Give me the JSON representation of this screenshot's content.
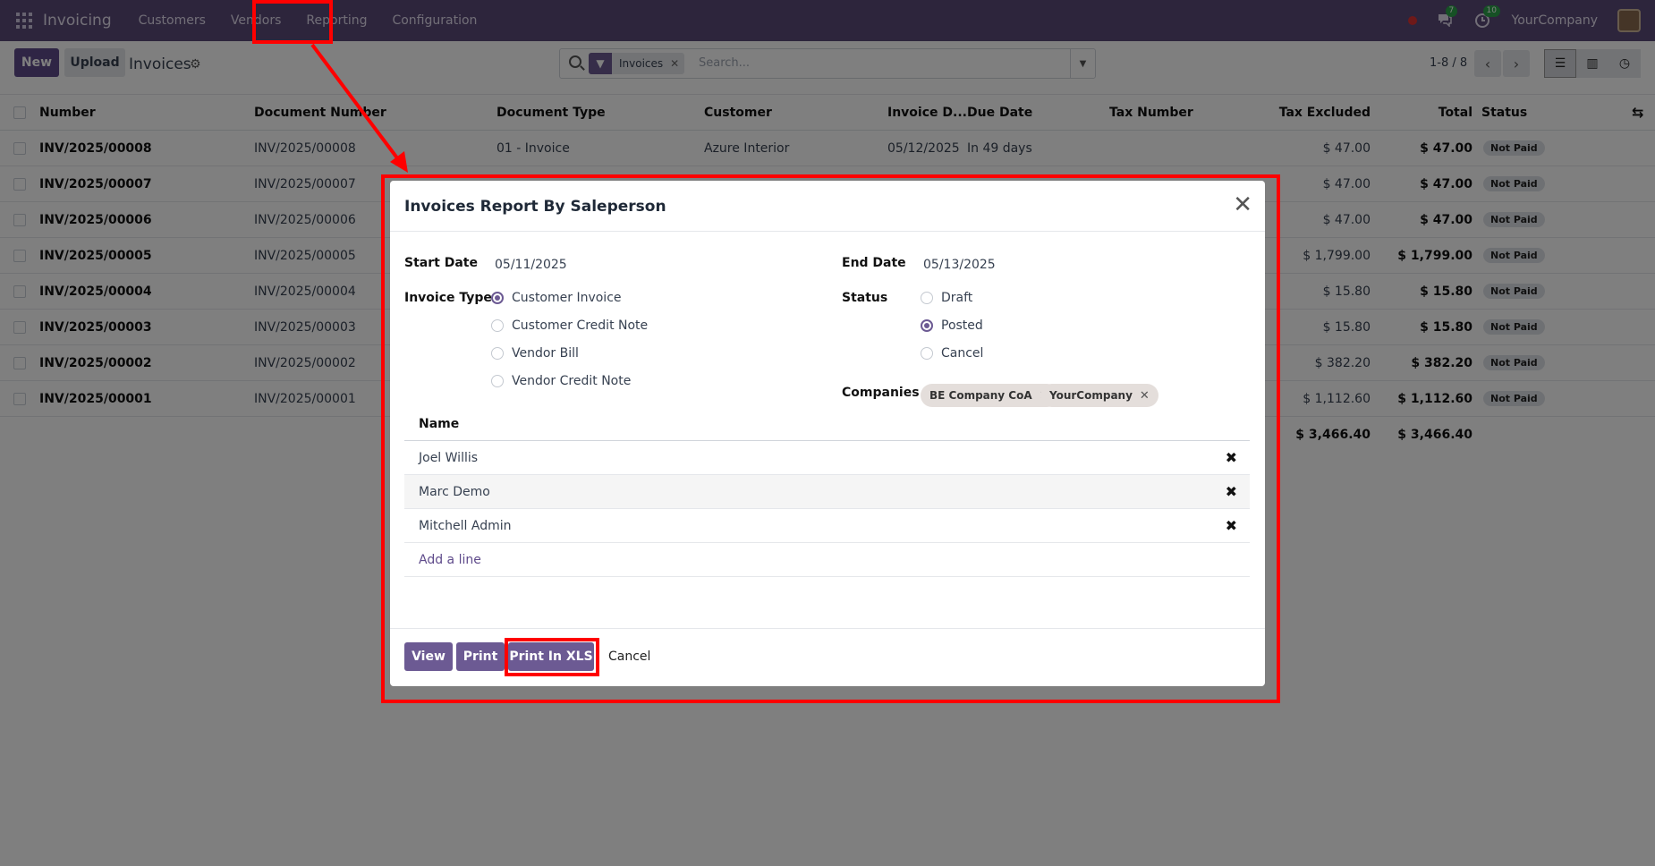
{
  "navbar": {
    "app_name": "Invoicing",
    "menu": [
      "Customers",
      "Vendors",
      "Reporting",
      "Configuration"
    ],
    "messages_count": "7",
    "activities_count": "10",
    "company": "YourCompany"
  },
  "control": {
    "new_label": "New",
    "upload_label": "Upload",
    "breadcrumb": "Invoices",
    "facet": "Invoices",
    "search_placeholder": "Search...",
    "pager": "1-8 / 8"
  },
  "table": {
    "headers": [
      "Number",
      "Document Number",
      "Document Type",
      "Customer",
      "Invoice D...",
      "Due Date",
      "Tax Number",
      "Tax Excluded",
      "Total",
      "Status"
    ],
    "rows": [
      {
        "number": "INV/2025/00008",
        "doc": "INV/2025/00008",
        "type": "01 - Invoice",
        "customer": "Azure Interior",
        "date": "05/12/2025",
        "due": "In 49 days",
        "excl": "$ 47.00",
        "total": "$ 47.00",
        "status": "Not Paid"
      },
      {
        "number": "INV/2025/00007",
        "doc": "INV/2025/00007",
        "excl": "$ 47.00",
        "total": "$ 47.00",
        "status": "Not Paid"
      },
      {
        "number": "INV/2025/00006",
        "doc": "INV/2025/00006",
        "excl": "$ 47.00",
        "total": "$ 47.00",
        "status": "Not Paid"
      },
      {
        "number": "INV/2025/00005",
        "doc": "INV/2025/00005",
        "excl": "$ 1,799.00",
        "total": "$ 1,799.00",
        "status": "Not Paid"
      },
      {
        "number": "INV/2025/00004",
        "doc": "INV/2025/00004",
        "excl": "$ 15.80",
        "total": "$ 15.80",
        "status": "Not Paid"
      },
      {
        "number": "INV/2025/00003",
        "doc": "INV/2025/00003",
        "excl": "$ 15.80",
        "total": "$ 15.80",
        "status": "Not Paid"
      },
      {
        "number": "INV/2025/00002",
        "doc": "INV/2025/00002",
        "excl": "$ 382.20",
        "total": "$ 382.20",
        "status": "Not Paid"
      },
      {
        "number": "INV/2025/00001",
        "doc": "INV/2025/00001",
        "excl": "$ 1,112.60",
        "total": "$ 1,112.60",
        "status": "Not Paid"
      }
    ],
    "total_excl": "$ 3,466.40",
    "total": "$ 3,466.40"
  },
  "dialog": {
    "title": "Invoices Report By Saleperson",
    "start_date_label": "Start Date",
    "start_date": "05/11/2025",
    "end_date_label": "End Date",
    "end_date": "05/13/2025",
    "invoice_type_label": "Invoice Type",
    "invoice_types": [
      "Customer Invoice",
      "Customer Credit Note",
      "Vendor Bill",
      "Vendor Credit Note"
    ],
    "selected_invoice_type": "Customer Invoice",
    "status_label": "Status",
    "statuses": [
      "Draft",
      "Posted",
      "Cancel"
    ],
    "selected_status": "Posted",
    "companies_label": "Companies",
    "companies": [
      "BE Company CoA",
      "YourCompany"
    ],
    "name_header": "Name",
    "salespersons": [
      "Joel Willis",
      "Marc Demo",
      "Mitchell Admin"
    ],
    "add_line": "Add a line",
    "buttons": {
      "view": "View",
      "print": "Print",
      "print_xls": "Print In XLS",
      "cancel": "Cancel"
    }
  },
  "colors": {
    "navbar": "#5b4a78",
    "primary": "#6c5a93",
    "annotation": "#ff0000"
  }
}
